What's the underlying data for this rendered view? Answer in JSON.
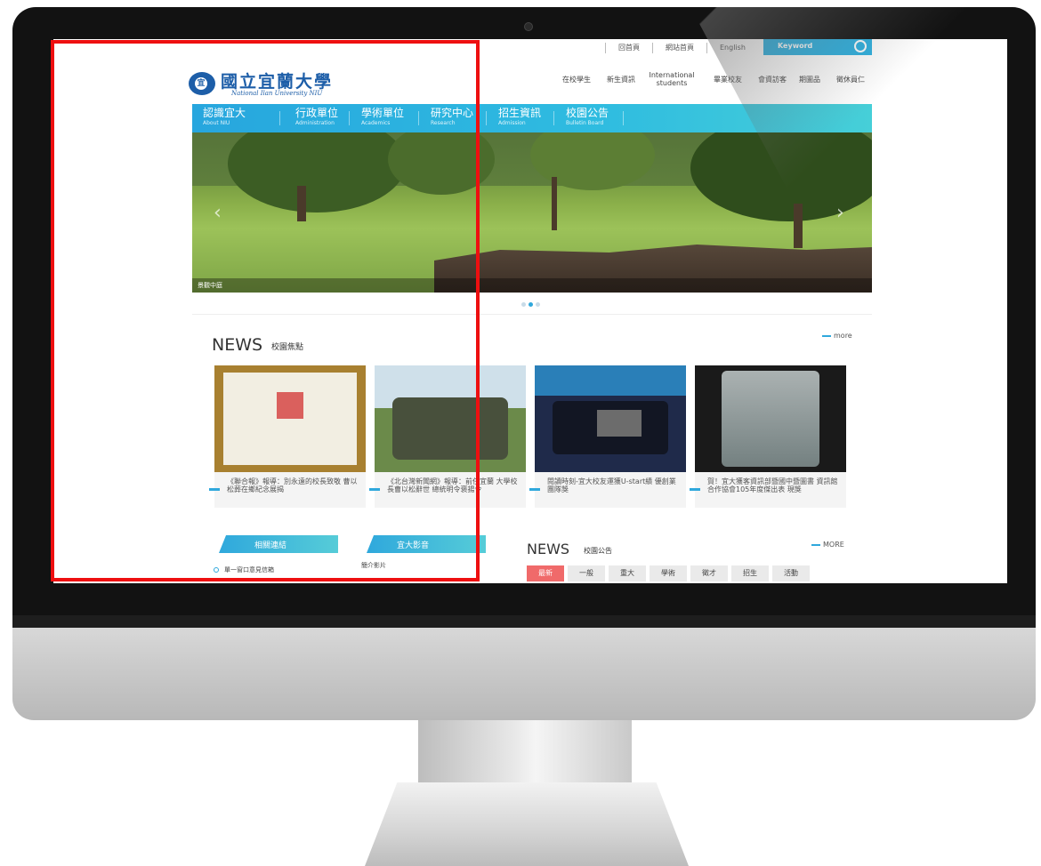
{
  "top_links": [
    "回首頁",
    "網站首頁",
    "English"
  ],
  "search": {
    "placeholder": "Keyword"
  },
  "logo": {
    "name_cn": "國立宜蘭大學",
    "name_en": "National Ilan University NIU"
  },
  "quick_nav": [
    "在校學生",
    "新生資訊",
    "International students",
    "畢業校友",
    "會資訪客",
    "期圖品",
    "徵休員仁"
  ],
  "main_nav": [
    {
      "cn": "認識宜大",
      "en": "About NIU"
    },
    {
      "cn": "行政單位",
      "en": "Administration"
    },
    {
      "cn": "學術單位",
      "en": "Academics"
    },
    {
      "cn": "研究中心",
      "en": "Research"
    },
    {
      "cn": "招生資訊",
      "en": "Admission"
    },
    {
      "cn": "校園公告",
      "en": "Bulletin Board"
    }
  ],
  "hero": {
    "caption": "景觀中庭",
    "slides": 3,
    "active_slide": 2
  },
  "news_focus": {
    "title": "NEWS",
    "subtitle": "校園焦點",
    "more": "more",
    "items": [
      "《聯合報》報導：別永遠的校長致敬 曹以松葬在鄉紀念展揭",
      "《北台灣新聞網》報導：前任宜蘭 大學校長曹以松辭世 總統明令褒揚令",
      "閱讀時刻-宜大校友運獲U-start績 優創業團隊獎",
      "賀！宜大獲客資訊部暨國中暨圖書 資訊館合作協會105年度傑出表 現獎"
    ]
  },
  "links_tab": {
    "label": "相關連結",
    "items": [
      "單一窗口意見信箱"
    ]
  },
  "video_tab": {
    "label": "宜大影音",
    "items": [
      "簡介影片"
    ]
  },
  "news_announce": {
    "title": "NEWS",
    "subtitle": "校園公告",
    "more": "MORE",
    "categories": [
      "最新",
      "一般",
      "重大",
      "學術",
      "徵才",
      "招生",
      "活動"
    ],
    "active_category": "最新"
  },
  "colors": {
    "accent": "#2fa8dc",
    "highlight": "#ee0f10",
    "category_active": "#f06a6a"
  }
}
